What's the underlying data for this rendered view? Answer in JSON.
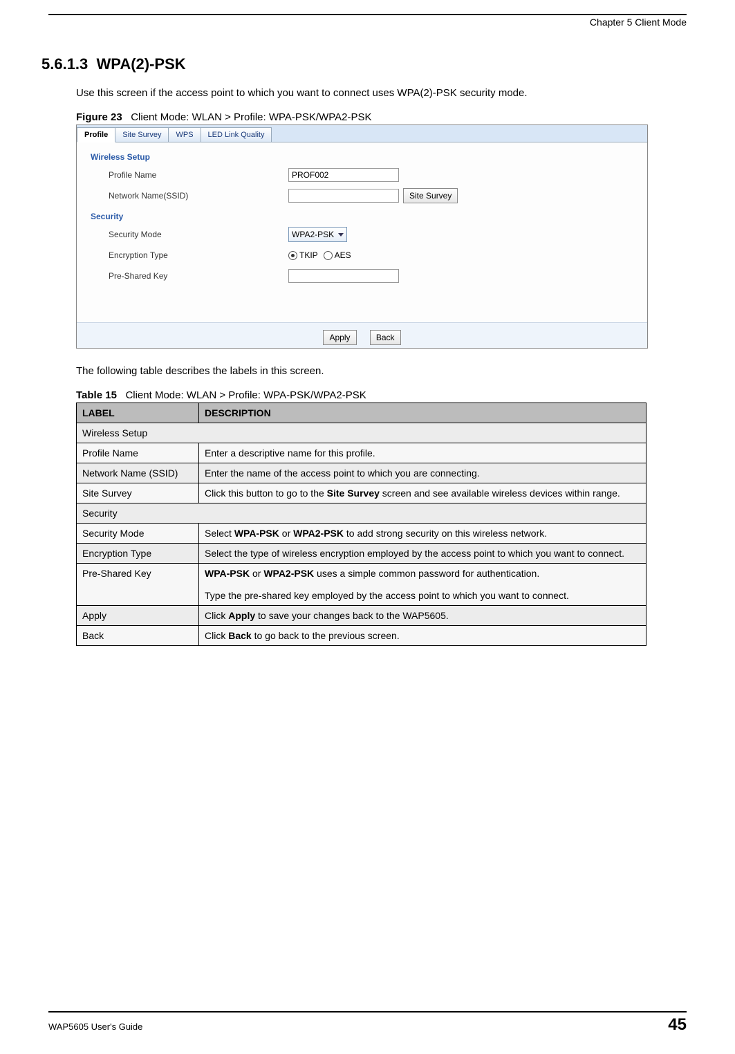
{
  "header": {
    "chapter": "Chapter 5 Client Mode"
  },
  "section": {
    "number": "5.6.1.3",
    "title": "WPA(2)-PSK"
  },
  "para1": "Use this screen if the access point to which you want to connect uses WPA(2)-PSK security mode.",
  "fig": {
    "label": "Figure 23",
    "caption": "Client Mode: WLAN > Profile: WPA-PSK/WPA2-PSK"
  },
  "screenshot": {
    "tabs": [
      "Profile",
      "Site Survey",
      "WPS",
      "LED Link Quality"
    ],
    "active_tab": "Profile",
    "group1": "Wireless Setup",
    "profile_name_label": "Profile Name",
    "profile_name_value": "PROF002",
    "ssid_label": "Network Name(SSID)",
    "ssid_value": "",
    "site_survey_btn": "Site Survey",
    "group2": "Security",
    "sec_mode_label": "Security Mode",
    "sec_mode_value": "WPA2-PSK",
    "enc_type_label": "Encryption Type",
    "enc_opt1": "TKIP",
    "enc_opt2": "AES",
    "psk_label": "Pre-Shared Key",
    "psk_value": "",
    "apply_btn": "Apply",
    "back_btn": "Back"
  },
  "para2": "The following table describes the labels in this screen.",
  "tablecap": {
    "label": "Table 15",
    "caption": "Client Mode: WLAN > Profile: WPA-PSK/WPA2-PSK"
  },
  "th": {
    "c1": "LABEL",
    "c2": "DESCRIPTION"
  },
  "rows": {
    "r0c1": "Wireless Setup",
    "r1c1": "Profile Name",
    "r1c2": "Enter a descriptive name for this profile.",
    "r2c1": "Network Name (SSID)",
    "r2c2": "Enter the name of the access point to which you are connecting.",
    "r3c1": "Site Survey",
    "r3c2a": "Click this button to go to the ",
    "r3c2b": "Site Survey",
    "r3c2c": " screen and see available wireless devices within range.",
    "r4c1": "Security",
    "r5c1": "Security Mode",
    "r5c2a": "Select ",
    "r5c2b": "WPA-PSK",
    "r5c2c": " or ",
    "r5c2d": "WPA2-PSK",
    "r5c2e": " to add strong security on this wireless network.",
    "r6c1": "Encryption Type",
    "r6c2": "Select the type of wireless encryption employed by the access point to which you want to connect.",
    "r7c1": "Pre-Shared Key",
    "r7c2a": "WPA-PSK",
    "r7c2b": " or ",
    "r7c2c": "WPA2-PSK",
    "r7c2d": " uses a simple common password for authentication.",
    "r7c2e": "Type the pre-shared key employed by the access point to which you want to connect.",
    "r8c1": "Apply",
    "r8c2a": "Click ",
    "r8c2b": "Apply",
    "r8c2c": " to save your changes back to the WAP5605.",
    "r9c1": "Back",
    "r9c2a": "Click ",
    "r9c2b": "Back",
    "r9c2c": " to go back to the previous screen."
  },
  "footer": {
    "left": "WAP5605 User's Guide",
    "page": "45"
  }
}
